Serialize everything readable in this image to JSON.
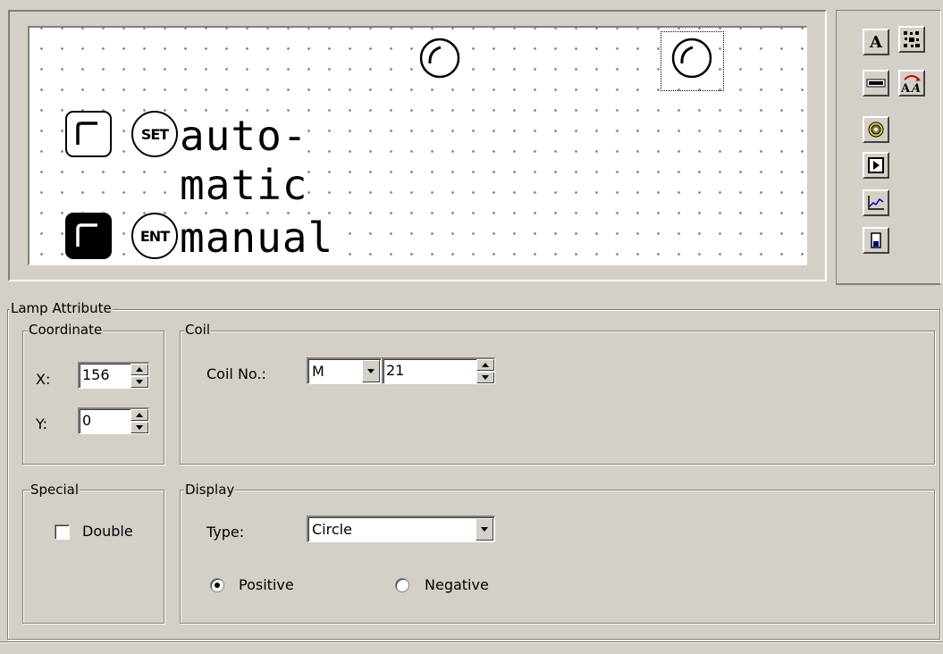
{
  "canvas": {
    "lines": [
      "auto-",
      "matic",
      "manual"
    ],
    "keys": [
      "SET",
      "ENT"
    ]
  },
  "toolbar": {
    "icons": [
      "text-icon",
      "bitmap-icon",
      "bar-icon",
      "font-size-icon",
      "lamp-icon",
      "button-icon",
      "chart-icon",
      "exit-icon"
    ]
  },
  "lamp_attribute": {
    "title": "Lamp Attribute",
    "coordinate": {
      "title": "Coordinate",
      "x_label": "X:",
      "x_value": "156",
      "y_label": "Y:",
      "y_value": "0"
    },
    "coil": {
      "title": "Coil",
      "coil_no_label": "Coil No.:",
      "coil_type": "M",
      "coil_number": "21"
    },
    "special": {
      "title": "Special",
      "double_label": "Double",
      "double_checked": false
    },
    "display": {
      "title": "Display",
      "type_label": "Type:",
      "type_value": "Circle",
      "positive_label": "Positive",
      "negative_label": "Negative",
      "selected": "Positive"
    }
  }
}
